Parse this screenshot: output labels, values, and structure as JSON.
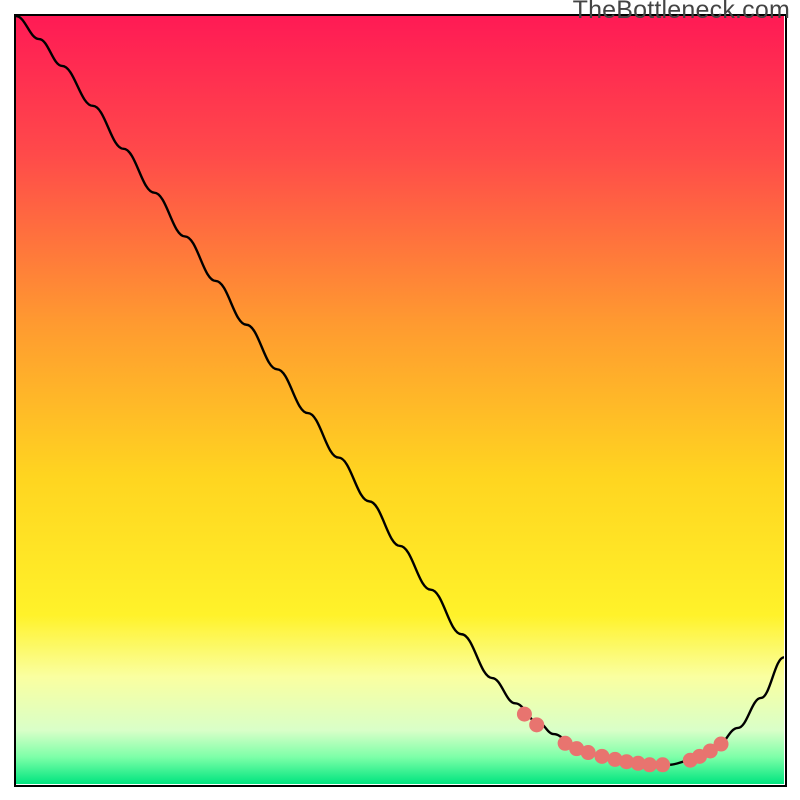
{
  "watermark": "TheBottleneck.com",
  "chart_data": {
    "type": "line",
    "title": "",
    "xlabel": "",
    "ylabel": "",
    "xlim": [
      0,
      100
    ],
    "ylim": [
      0,
      100
    ],
    "grid": false,
    "legend": false,
    "background_gradient_stops": [
      {
        "offset": 0,
        "color": "#ff1a55"
      },
      {
        "offset": 0.18,
        "color": "#ff4a4a"
      },
      {
        "offset": 0.4,
        "color": "#ff9a30"
      },
      {
        "offset": 0.6,
        "color": "#ffd520"
      },
      {
        "offset": 0.78,
        "color": "#fff22a"
      },
      {
        "offset": 0.86,
        "color": "#faffa0"
      },
      {
        "offset": 0.93,
        "color": "#d9ffc8"
      },
      {
        "offset": 0.965,
        "color": "#7dffa8"
      },
      {
        "offset": 1.0,
        "color": "#00e57f"
      }
    ],
    "series": [
      {
        "name": "curve",
        "color": "#000000",
        "width": 2.4,
        "x": [
          0,
          3,
          6,
          10,
          14,
          18,
          22,
          26,
          30,
          34,
          38,
          42,
          46,
          50,
          54,
          58,
          62,
          65,
          68,
          70,
          73,
          76,
          79,
          82,
          85,
          88,
          91,
          94,
          97,
          100
        ],
        "y": [
          100,
          97,
          93.5,
          88.3,
          82.7,
          77,
          71.3,
          65.5,
          59.8,
          54,
          48.3,
          42.5,
          36.8,
          31,
          25.3,
          19.5,
          13.8,
          10.5,
          8.0,
          6.5,
          4.8,
          3.6,
          2.9,
          2.5,
          2.5,
          3.1,
          4.6,
          7.3,
          11.2,
          16.5
        ]
      }
    ],
    "markers": {
      "name": "dots",
      "color": "#e8746f",
      "radius": 7.5,
      "x": [
        66.2,
        67.8,
        71.5,
        73.0,
        74.5,
        76.3,
        78.0,
        79.5,
        81.0,
        82.5,
        84.2,
        87.8,
        89.0,
        90.4,
        91.8
      ],
      "y": [
        9.1,
        7.7,
        5.3,
        4.6,
        4.1,
        3.6,
        3.2,
        2.9,
        2.7,
        2.5,
        2.5,
        3.1,
        3.6,
        4.3,
        5.2
      ]
    }
  }
}
